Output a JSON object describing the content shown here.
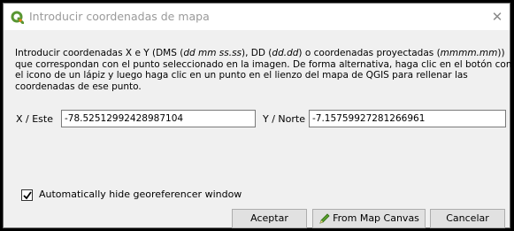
{
  "window": {
    "title": "Introducir coordenadas de mapa",
    "close_glyph": "✕",
    "icon": "qgis-logo-icon"
  },
  "description": {
    "lines": [
      "Introducir coordenadas X e Y (DMS (dd mm ss.ss), DD (dd.dd) o coordenadas proyectadas (mmmm.mm))",
      "que correspondan con el punto seleccionado en la imagen. De forma alternativa, haga clic en el botón con",
      "el icono de un lápiz y luego haga clic en un punto en el lienzo del mapa de QGIS para rellenar las",
      "coordenadas de ese punto."
    ],
    "segments": {
      "l1a": "Introducir coordenadas X e Y (DMS (",
      "l1b": "dd mm ss.ss",
      "l1c": "), DD (",
      "l1d": "dd.dd",
      "l1e": ") o coordenadas proyectadas (",
      "l1f": "mmmm.mm",
      "l1g": "))"
    }
  },
  "fields": {
    "x_label": "X / Este",
    "x_value": "-78.52512992428987104",
    "y_label": "Y / Norte",
    "y_value": "-7.15759927281266961"
  },
  "options": {
    "auto_hide_label": "Automatically hide georeferencer window",
    "auto_hide_checked": true
  },
  "buttons": {
    "accept": "Aceptar",
    "from_canvas": "From Map Canvas",
    "cancel": "Cancelar"
  },
  "colors": {
    "qgis_green": "#589632",
    "qgis_yellow": "#ee7913",
    "pencil_green": "#5aa02c"
  }
}
